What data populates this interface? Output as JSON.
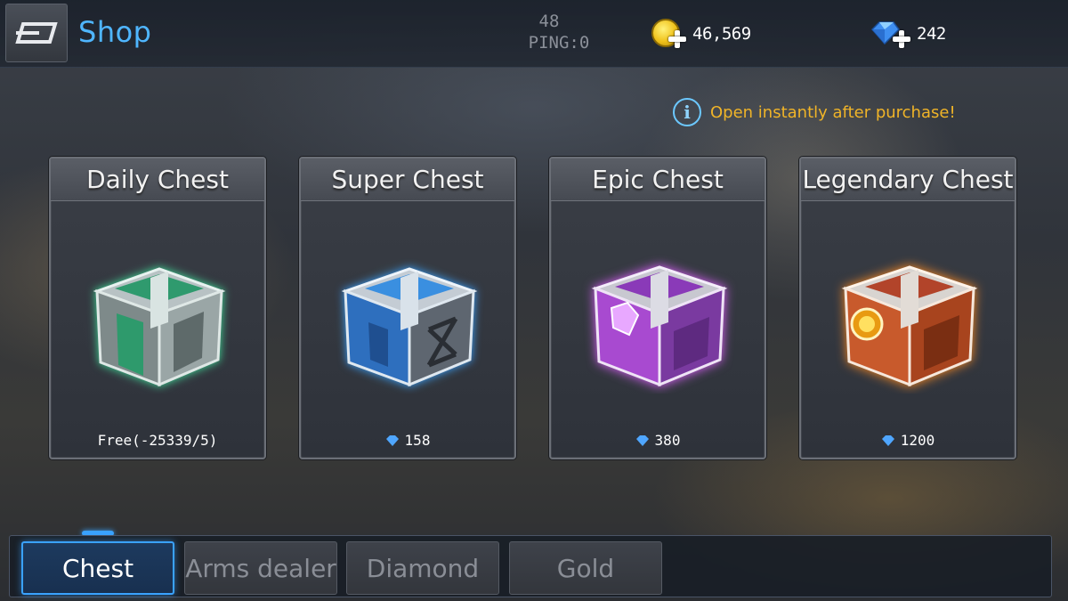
{
  "header": {
    "title": "Shop",
    "ping_value": "48",
    "ping_label": "PING:0",
    "gold": "46,569",
    "diamonds": "242"
  },
  "notice": "Open instantly after purchase!",
  "chests": [
    {
      "name": "Daily Chest",
      "price": "Free(-25339/5)",
      "currency": "none",
      "color": "#35c48a"
    },
    {
      "name": "Super Chest",
      "price": "158",
      "currency": "diamond",
      "color": "#3a8fe0"
    },
    {
      "name": "Epic Chest",
      "price": "380",
      "currency": "diamond",
      "color": "#b94ad8"
    },
    {
      "name": "Legendary Chest",
      "price": "1200",
      "currency": "diamond",
      "color": "#f07a1c"
    }
  ],
  "tabs": [
    {
      "label": "Chest",
      "active": true
    },
    {
      "label": "Arms dealer",
      "active": false
    },
    {
      "label": "Diamond",
      "active": false
    },
    {
      "label": "Gold",
      "active": false
    }
  ],
  "colors": {
    "accent": "#3aa2ff",
    "title": "#4fb6ff",
    "notice": "#f0b428"
  },
  "icons": {
    "back": "back-arrow-icon",
    "gold": "gold-coin-plus-icon",
    "diamond": "diamond-plus-icon",
    "info": "info-icon"
  }
}
